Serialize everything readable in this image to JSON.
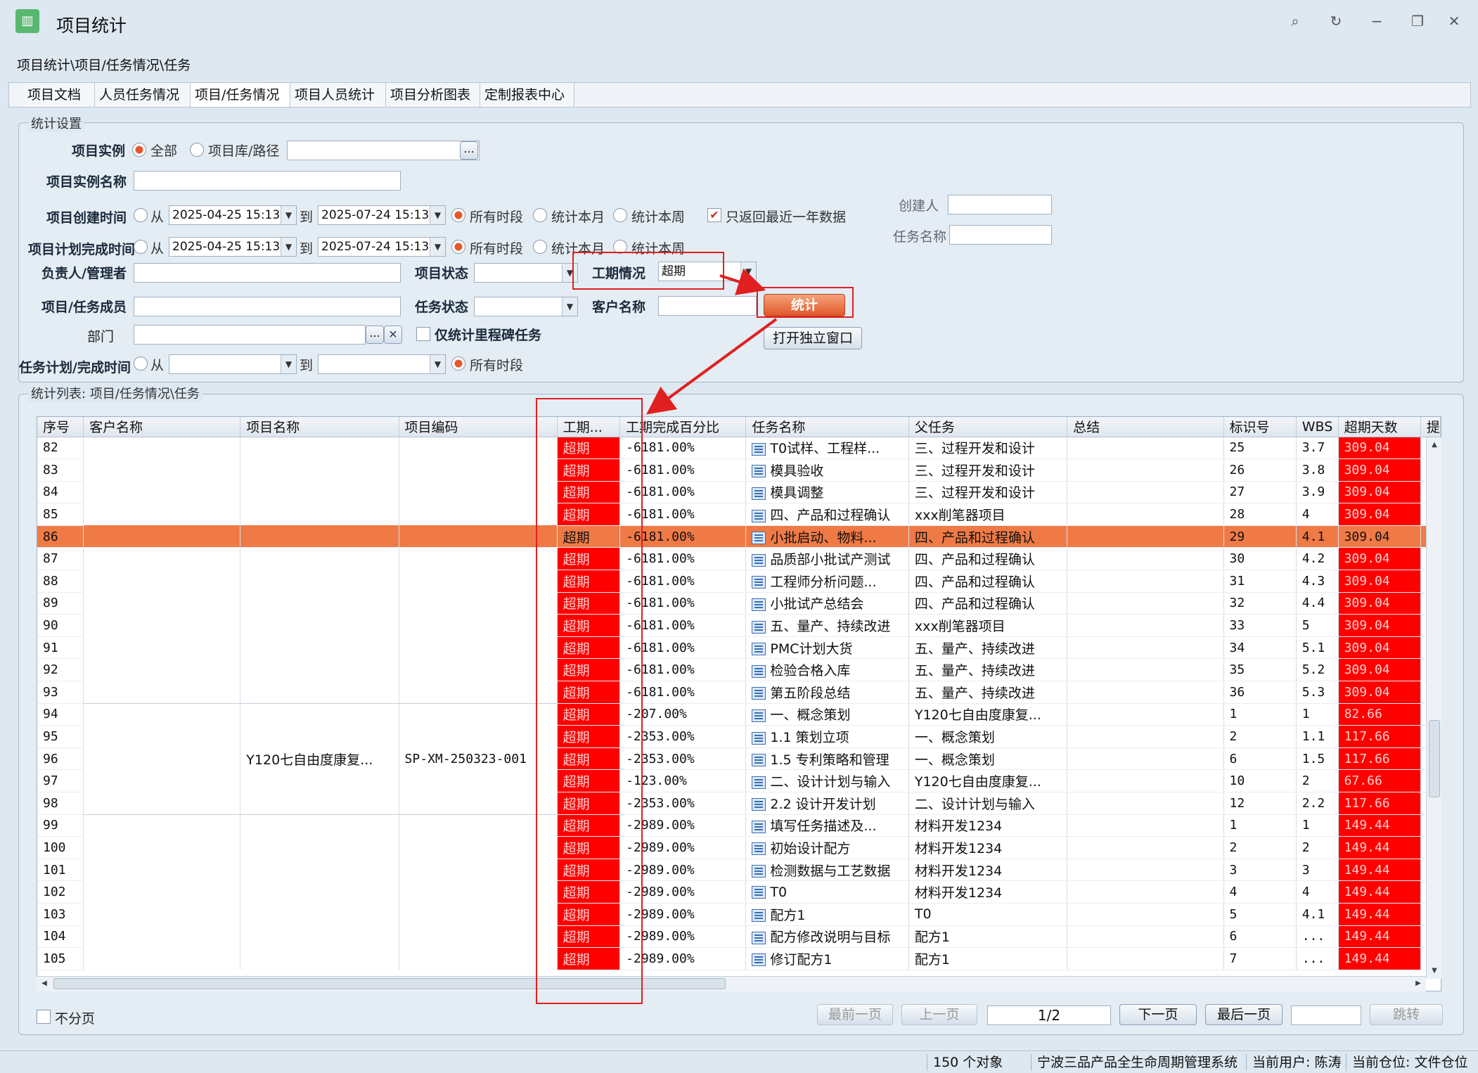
{
  "window": {
    "title": "项目统计"
  },
  "breadcrumb": "项目统计\\项目/任务情况\\任务",
  "tabs": [
    "项目文档",
    "人员任务情况",
    "项目/任务情况",
    "项目人员统计",
    "项目分析图表",
    "定制报表中心"
  ],
  "settings": {
    "group_title": "统计设置",
    "instance_label": "项目实例",
    "instance_all": "全部",
    "instance_path": "项目库/路径",
    "instance_name_label": "项目实例名称",
    "create_time_label": "项目创建时间",
    "plan_finish_label": "项目计划完成时间",
    "from": "从",
    "to": "到",
    "create_from": "2025-04-25 15:13:",
    "create_to": "2025-07-24 15:13:",
    "plan_from": "2025-04-25 15:13:",
    "plan_to": "2025-07-24 15:13:",
    "all_period": "所有时段",
    "this_month": "统计本月",
    "this_week": "统计本周",
    "last_year_only": "只返回最近一年数据",
    "creator_label": "创建人",
    "task_name_label": "任务名称",
    "owner_label": "负责人/管理者",
    "project_status_label": "项目状态",
    "schedule_label": "工期情况",
    "schedule_value": "超期",
    "members_label": "项目/任务成员",
    "task_status_label": "任务状态",
    "customer_label": "客户名称",
    "stat_button": "统计",
    "open_window_button": "打开独立窗口",
    "dept_label": "部门",
    "milestone_only": "仅统计里程碑任务",
    "task_plan_label": "任务计划/完成时间",
    "browse": "..."
  },
  "list": {
    "group_title": "统计列表: 项目/任务情况\\任务",
    "columns": [
      "序号",
      "客户名称",
      "项目名称",
      "项目编码",
      "工期...",
      "工期完成百分比",
      "任务名称",
      "父任务",
      "总结",
      "标识号",
      "WBS",
      "超期天数",
      "提"
    ],
    "merged_project_name": "Y120七自由度康复...",
    "merged_project_code": "SP-XM-250323-001",
    "rows": [
      {
        "no": "82",
        "status": "超期",
        "pct": "-6181.00%",
        "task": "T0试样、工程样...",
        "parent": "三、过程开发和设计",
        "id": "25",
        "wbs": "3.7",
        "days": "309.04"
      },
      {
        "no": "83",
        "status": "超期",
        "pct": "-6181.00%",
        "task": "模具验收",
        "parent": "三、过程开发和设计",
        "id": "26",
        "wbs": "3.8",
        "days": "309.04"
      },
      {
        "no": "84",
        "status": "超期",
        "pct": "-6181.00%",
        "task": "模具调整",
        "parent": "三、过程开发和设计",
        "id": "27",
        "wbs": "3.9",
        "days": "309.04"
      },
      {
        "no": "85",
        "status": "超期",
        "pct": "-6181.00%",
        "task": "四、产品和过程确认",
        "parent": "xxx削笔器项目",
        "id": "28",
        "wbs": "4",
        "days": "309.04"
      },
      {
        "no": "86",
        "status": "超期",
        "pct": "-6181.00%",
        "task": "小批启动、物料...",
        "parent": "四、产品和过程确认",
        "id": "29",
        "wbs": "4.1",
        "days": "309.04",
        "selected": true
      },
      {
        "no": "87",
        "status": "超期",
        "pct": "-6181.00%",
        "task": "品质部小批试产测试",
        "parent": "四、产品和过程确认",
        "id": "30",
        "wbs": "4.2",
        "days": "309.04"
      },
      {
        "no": "88",
        "status": "超期",
        "pct": "-6181.00%",
        "task": "工程师分析问题...",
        "parent": "四、产品和过程确认",
        "id": "31",
        "wbs": "4.3",
        "days": "309.04"
      },
      {
        "no": "89",
        "status": "超期",
        "pct": "-6181.00%",
        "task": "小批试产总结会",
        "parent": "四、产品和过程确认",
        "id": "32",
        "wbs": "4.4",
        "days": "309.04"
      },
      {
        "no": "90",
        "status": "超期",
        "pct": "-6181.00%",
        "task": "五、量产、持续改进",
        "parent": "xxx削笔器项目",
        "id": "33",
        "wbs": "5",
        "days": "309.04"
      },
      {
        "no": "91",
        "status": "超期",
        "pct": "-6181.00%",
        "task": "PMC计划大货",
        "parent": "五、量产、持续改进",
        "id": "34",
        "wbs": "5.1",
        "days": "309.04"
      },
      {
        "no": "92",
        "status": "超期",
        "pct": "-6181.00%",
        "task": "检验合格入库",
        "parent": "五、量产、持续改进",
        "id": "35",
        "wbs": "5.2",
        "days": "309.04"
      },
      {
        "no": "93",
        "status": "超期",
        "pct": "-6181.00%",
        "task": "第五阶段总结",
        "parent": "五、量产、持续改进",
        "id": "36",
        "wbs": "5.3",
        "days": "309.04"
      },
      {
        "no": "94",
        "status": "超期",
        "pct": "-207.00%",
        "task": "一、概念策划",
        "parent": "Y120七自由度康复...",
        "id": "1",
        "wbs": "1",
        "days": "82.66"
      },
      {
        "no": "95",
        "status": "超期",
        "pct": "-2353.00%",
        "task": "1.1 策划立项",
        "parent": "一、概念策划",
        "id": "2",
        "wbs": "1.1",
        "days": "117.66"
      },
      {
        "no": "96",
        "status": "超期",
        "pct": "-2353.00%",
        "task": "1.5 专利策略和管理",
        "parent": "一、概念策划",
        "id": "6",
        "wbs": "1.5",
        "days": "117.66"
      },
      {
        "no": "97",
        "status": "超期",
        "pct": "-123.00%",
        "task": "二、设计计划与输入",
        "parent": "Y120七自由度康复...",
        "id": "10",
        "wbs": "2",
        "days": "67.66"
      },
      {
        "no": "98",
        "status": "超期",
        "pct": "-2353.00%",
        "task": "2.2 设计开发计划",
        "parent": "二、设计计划与输入",
        "id": "12",
        "wbs": "2.2",
        "days": "117.66"
      },
      {
        "no": "99",
        "status": "超期",
        "pct": "-2989.00%",
        "task": "填写任务描述及...",
        "parent": "材料开发1234",
        "id": "1",
        "wbs": "1",
        "days": "149.44"
      },
      {
        "no": "100",
        "status": "超期",
        "pct": "-2989.00%",
        "task": "初始设计配方",
        "parent": "材料开发1234",
        "id": "2",
        "wbs": "2",
        "days": "149.44"
      },
      {
        "no": "101",
        "status": "超期",
        "pct": "-2989.00%",
        "task": "检测数据与工艺数据",
        "parent": "材料开发1234",
        "id": "3",
        "wbs": "3",
        "days": "149.44"
      },
      {
        "no": "102",
        "status": "超期",
        "pct": "-2989.00%",
        "task": "T0",
        "parent": "材料开发1234",
        "id": "4",
        "wbs": "4",
        "days": "149.44"
      },
      {
        "no": "103",
        "status": "超期",
        "pct": "-2989.00%",
        "task": "配方1",
        "parent": "T0",
        "id": "5",
        "wbs": "4.1",
        "days": "149.44"
      },
      {
        "no": "104",
        "status": "超期",
        "pct": "-2989.00%",
        "task": "配方修改说明与目标",
        "parent": "配方1",
        "id": "6",
        "wbs": "...",
        "days": "149.44"
      },
      {
        "no": "105",
        "status": "超期",
        "pct": "-2989.00%",
        "task": "修订配方1",
        "parent": "配方1",
        "id": "7",
        "wbs": "...",
        "days": "149.44"
      }
    ]
  },
  "pager": {
    "no_paging": "不分页",
    "first": "最前一页",
    "prev": "上一页",
    "page": "1/2",
    "next": "下一页",
    "last": "最后一页",
    "jump": "跳转"
  },
  "status": {
    "count": "150 个对象",
    "system": "宁波三品产品全生命周期管理系统",
    "user": "当前用户: 陈涛",
    "location": "当前仓位: 文件仓位"
  },
  "colors": {
    "overdue": "#ff0000",
    "selected_row": "#f07a46",
    "annotation": "#e02020"
  }
}
